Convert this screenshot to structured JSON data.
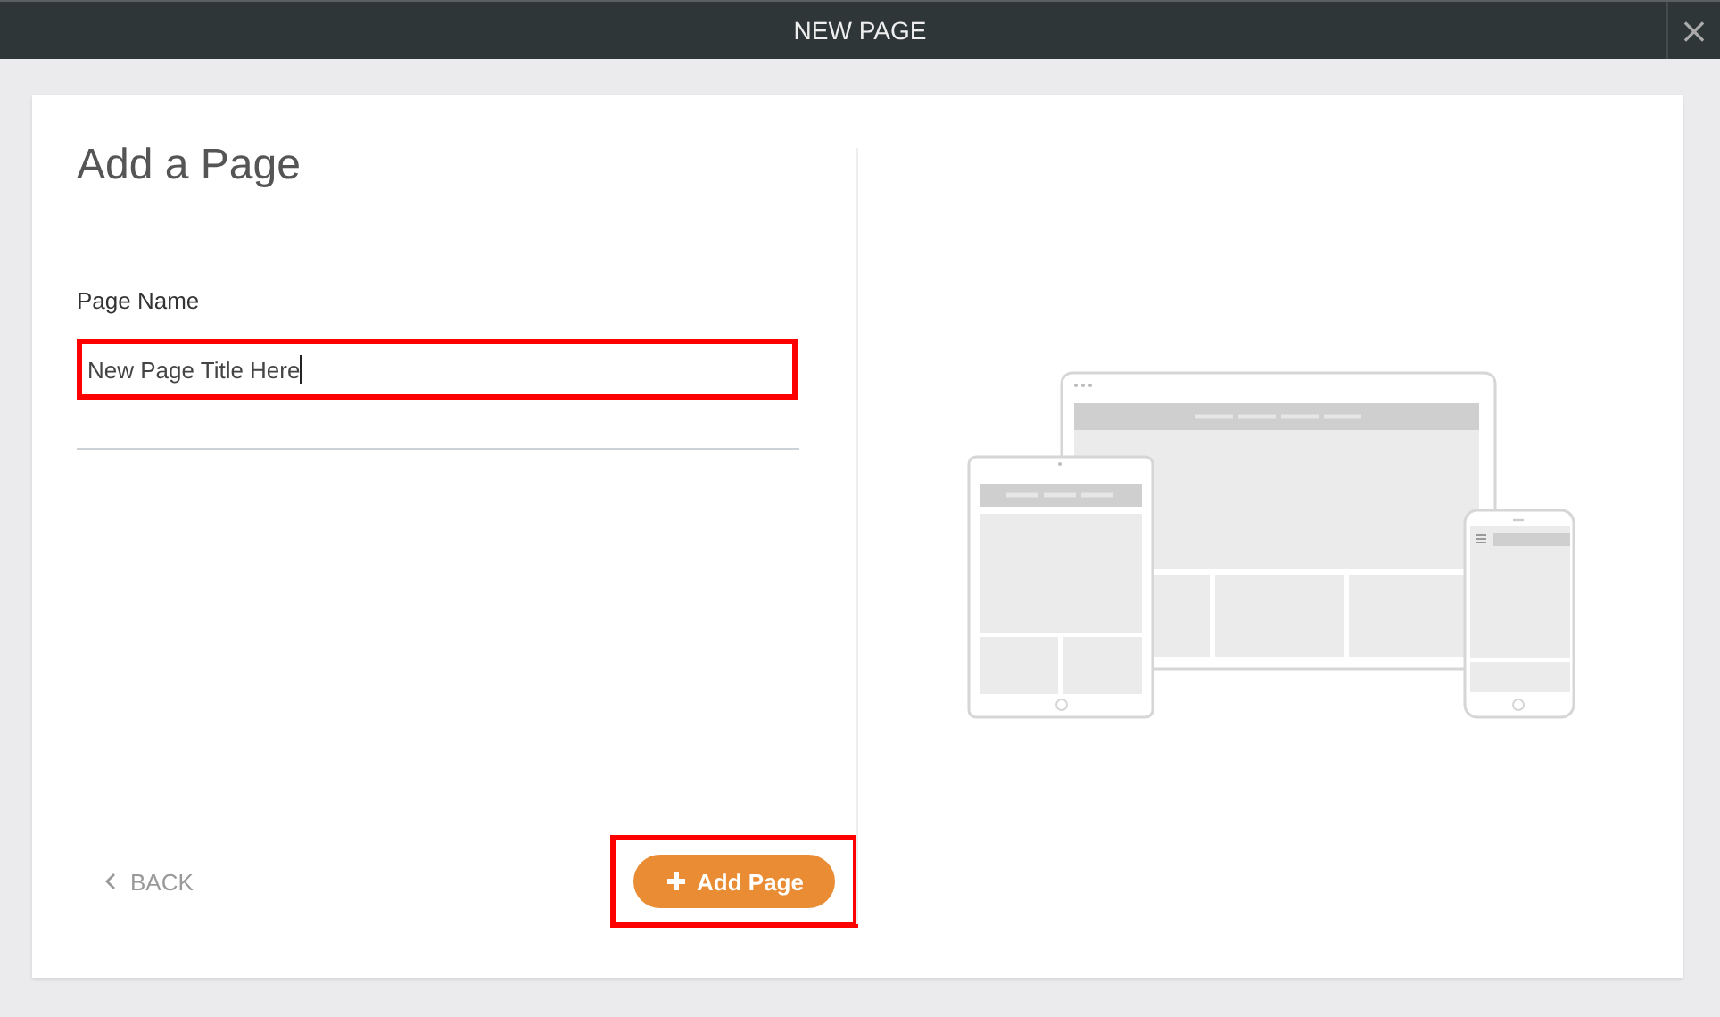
{
  "window": {
    "title": "NEW PAGE",
    "close": "×"
  },
  "heading": "Add a Page",
  "page_name": {
    "label": "Page Name",
    "value": "New Page Title Here",
    "highlighted": true
  },
  "back_button": {
    "label": "BACK"
  },
  "add_button": {
    "label": "Add Page",
    "highlighted": true
  }
}
